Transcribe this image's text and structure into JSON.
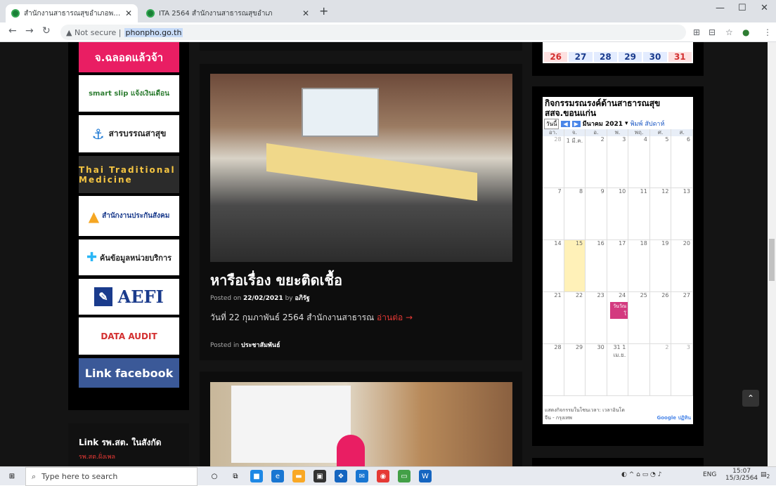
{
  "browser": {
    "tabs": [
      {
        "title": "สำนักงานสาธารณสุขอำเภอพล | Pho"
      },
      {
        "title": "ITA 2564 สำนักงานสาธารณสุขอำเภ"
      }
    ],
    "new_tab": "+",
    "url_prefix": "Not secure |",
    "url": "phonpho.go.th"
  },
  "sidebar": {
    "banners": [
      {
        "text": "จ.ฉลอดแล้วจ้า",
        "bg": "#e91e63",
        "color": "#ffffff"
      },
      {
        "text": "smart slip แจ้งเงินเดือน",
        "bg": "#ffffff",
        "color": "#2e7d32"
      },
      {
        "text": "สารบรรณสาสุข",
        "bg": "#ffffff",
        "color": "#222222"
      },
      {
        "text": "Thai Traditional Medicine",
        "bg": "#2b2b2b",
        "color": "#f5c542"
      },
      {
        "text": "สำนักงานประกันสังคม",
        "bg": "#ffffff",
        "color": "#1a3b8c"
      },
      {
        "text": "ค้นข้อมูลหน่วยบริการ",
        "bg": "#ffffff",
        "color": "#222222"
      },
      {
        "text": "AEFI",
        "bg": "#ffffff",
        "color": "#1a3b8c"
      },
      {
        "text": "DATA AUDIT",
        "bg": "#ffffff",
        "color": "#d32f2f"
      },
      {
        "text": "Link facebook",
        "bg": "#3b5998",
        "color": "#ffffff"
      }
    ],
    "links_title": "Link รพ.สต. ในสังกัด",
    "links_sub": "รพ.สต.ฝั่งเพล"
  },
  "posts": [
    {
      "title": "หารือเรื่อง ขยะติดเชื้อ",
      "posted_on_label": "Posted on",
      "date": "22/02/2021",
      "by_label": "by",
      "author": "อภิรัฐ",
      "excerpt": "วันที่ 22 กุมภาพันธ์ 2564 สำนักงานสาธารณ",
      "read_more": "อ่านต่อ →",
      "posted_in_label": "Posted in",
      "category": "ประชาสัมพันธ์"
    }
  ],
  "calendar": {
    "title": "กิจกรรมรณรงค์ด้านสาธารณสุข สสจ.ขอนแก่น",
    "today_btn": "วันนี้",
    "prev": "◀",
    "next": "▶",
    "month": "มีนาคม 2021",
    "print": "พิมพ์",
    "week": "สัปดาห์",
    "dow": [
      "อา.",
      "จ.",
      "อ.",
      "พ.",
      "พฤ.",
      "ศ.",
      "ส."
    ],
    "weeks": [
      [
        "28",
        "1 มี.ค.",
        "2",
        "3",
        "4",
        "5",
        "6"
      ],
      [
        "7",
        "8",
        "9",
        "10",
        "11",
        "12",
        "13"
      ],
      [
        "14",
        "15",
        "16",
        "17",
        "18",
        "19",
        "20"
      ],
      [
        "21",
        "22",
        "23",
        "24",
        "25",
        "26",
        "27"
      ],
      [
        "28",
        "29",
        "30",
        "31 1 เม.ย.",
        "",
        "2",
        "3"
      ]
    ],
    "event_label": "วันวัณโ",
    "footer": "แสดงกิจกรรมในโซนเวลา: เวลาอินโดจีน - กรุงเทพ",
    "google": "Google ปฏิทิน",
    "strip_dates": [
      "26",
      "27",
      "28",
      "29",
      "30",
      "31"
    ]
  },
  "taskbar": {
    "search_placeholder": "Type here to search",
    "lang": "ENG",
    "time": "15:07",
    "date": "15/3/2564",
    "notif": "2"
  }
}
